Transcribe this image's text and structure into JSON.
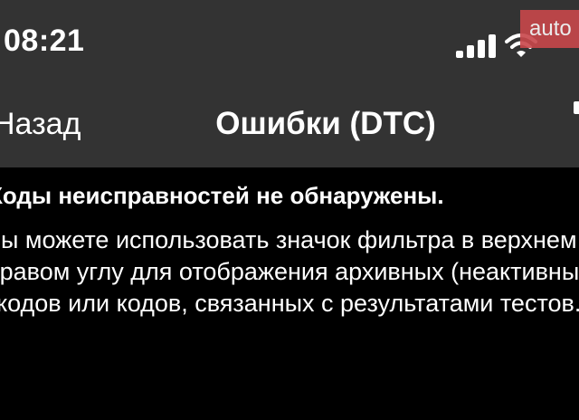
{
  "status_bar": {
    "time": "08:21",
    "signal_icon": "cellular-signal-icon",
    "wifi_icon": "wifi-icon"
  },
  "watermark": {
    "text": "auto"
  },
  "nav": {
    "back_label": "Назад",
    "title": "Ошибки (DTC)",
    "filter_icon": "filter-icon"
  },
  "content": {
    "heading": "Коды неисправностей не обнаружены.",
    "hint_lines": [
      "Вы можете использовать значок фильтра в верхнем",
      "правом углу для отображения архивных (неактивных)",
      "кодов или кодов, связанных с результатами тестов."
    ]
  },
  "colors": {
    "background": "#000000",
    "nav_background": "#333333",
    "text": "#ffffff",
    "watermark": "#c8474b"
  }
}
